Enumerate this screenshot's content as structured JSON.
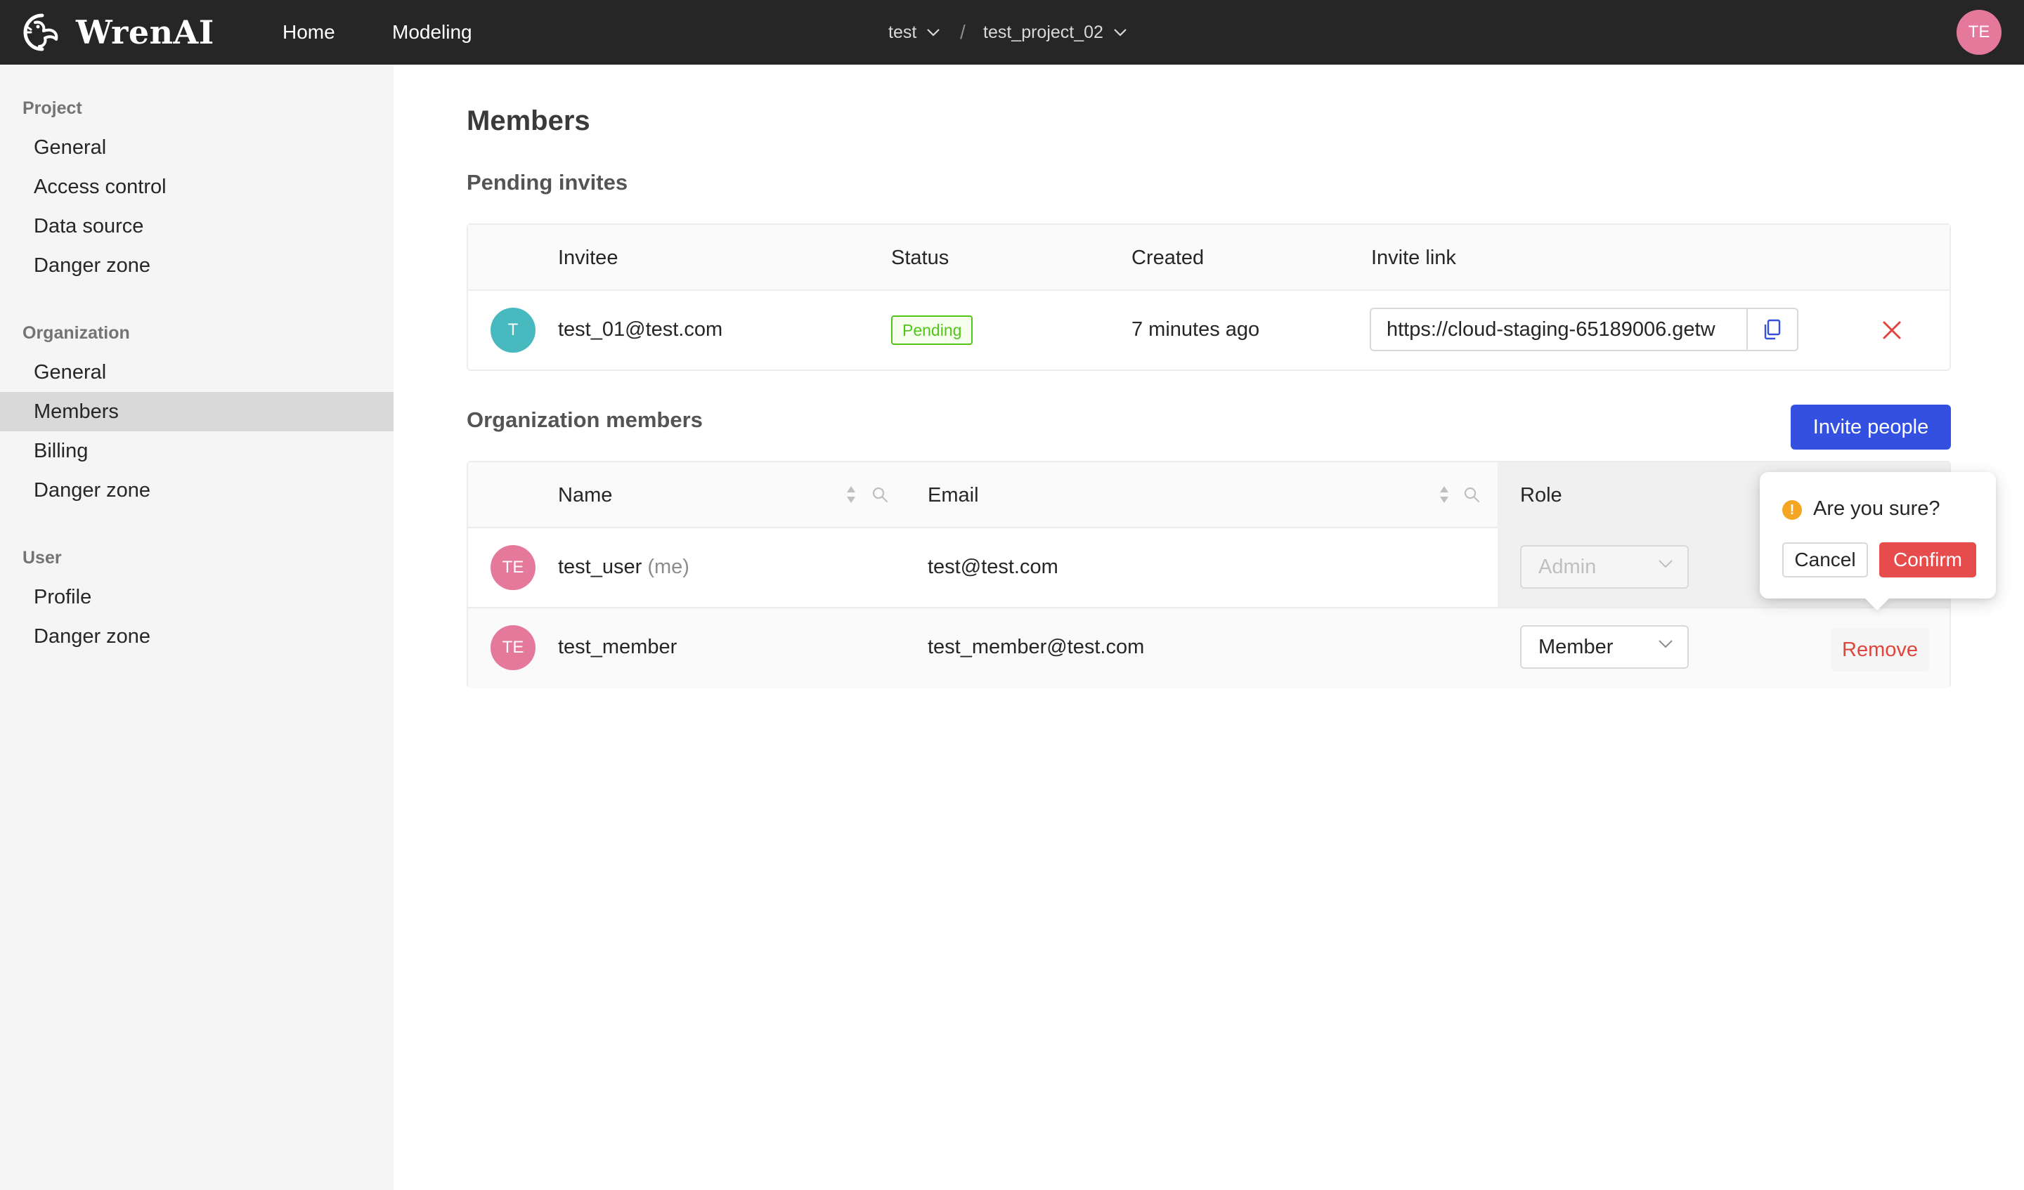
{
  "app": {
    "name": "WrenAI",
    "user_initials": "TE"
  },
  "nav": {
    "home": "Home",
    "modeling": "Modeling"
  },
  "breadcrumb": {
    "org": "test",
    "separator": "/",
    "project": "test_project_02"
  },
  "sidebar": {
    "groups": [
      {
        "title": "Project",
        "items": [
          "General",
          "Access control",
          "Data source",
          "Danger zone"
        ]
      },
      {
        "title": "Organization",
        "items": [
          "General",
          "Members",
          "Billing",
          "Danger zone"
        ]
      },
      {
        "title": "User",
        "items": [
          "Profile",
          "Danger zone"
        ]
      }
    ],
    "active_item": "Members"
  },
  "page": {
    "title": "Members"
  },
  "pending": {
    "title": "Pending invites",
    "columns": [
      "Invitee",
      "Status",
      "Created",
      "Invite link"
    ],
    "rows": [
      {
        "avatar": "T",
        "invitee": "test_01@test.com",
        "status": "Pending",
        "created": "7 minutes ago",
        "invite_link": "https://cloud-staging-65189006.getw"
      }
    ]
  },
  "members": {
    "title": "Organization members",
    "invite_button": "Invite people",
    "columns": [
      "Name",
      "Email",
      "Role"
    ],
    "rows": [
      {
        "avatar": "TE",
        "name": "test_user",
        "suffix": "(me)",
        "email": "test@test.com",
        "role": "Admin",
        "role_disabled": true
      },
      {
        "avatar": "TE",
        "name": "test_member",
        "email": "test_member@test.com",
        "role": "Member",
        "action": "Remove"
      }
    ]
  },
  "popconfirm": {
    "icon": "!",
    "message": "Are you sure?",
    "cancel": "Cancel",
    "confirm": "Confirm"
  },
  "colors": {
    "header_bg": "#262626",
    "primary": "#3450e0",
    "danger": "#e74c4c",
    "avatar_pink": "#e5799c",
    "avatar_teal": "#48b9bf",
    "pending_green": "#52c41a"
  },
  "icons": {
    "logo": "bird-logo-icon",
    "chevron": "chevron-down-icon",
    "copy": "copy-icon",
    "close": "close-icon",
    "sort": "sort-icon",
    "search": "search-icon",
    "warning": "warning-icon"
  }
}
